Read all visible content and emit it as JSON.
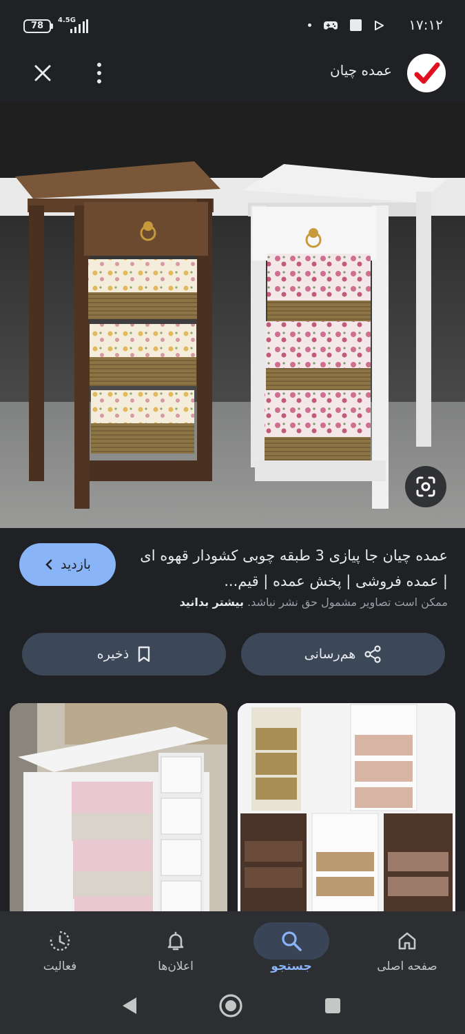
{
  "status_bar": {
    "time": "۱۷:۱۲",
    "battery": "78",
    "network": "4.5G",
    "icons": [
      "dot-icon",
      "gamepad-icon",
      "square-icon",
      "play-icon"
    ]
  },
  "header": {
    "site_name": "عمده چیان",
    "logo": "checkmark-logo",
    "close_icon": "close-icon",
    "more_icon": "more-vert-icon"
  },
  "main_image": {
    "alt": "two wooden nightstands with 3 wicker basket drawers",
    "lens_icon": "lens-icon"
  },
  "result": {
    "title": "عمده چیان جا پیازی 3 طبقه چوبی کشودار قهوه ای | عمده فروشی | پخش عمده | قیم...",
    "copyright_text": "ممکن است تصاویر مشمول حق نشر نباشد.",
    "learn_more": "بیشتر بدانید",
    "visit_label": "بازدید"
  },
  "actions": {
    "save_label": "ذخیره",
    "share_label": "هم‌رسانی"
  },
  "nav": [
    {
      "label": "صفحه اصلی",
      "icon": "home-icon"
    },
    {
      "label": "جستجو",
      "icon": "search-icon"
    },
    {
      "label": "اعلان‌ها",
      "icon": "bell-icon"
    },
    {
      "label": "فعالیت",
      "icon": "activity-icon"
    }
  ],
  "colors": {
    "background": "#202124",
    "accent": "#8ab4f8",
    "button": "#3c4758",
    "nav_bg": "#2d2e31",
    "logo_red": "#e0101e"
  }
}
